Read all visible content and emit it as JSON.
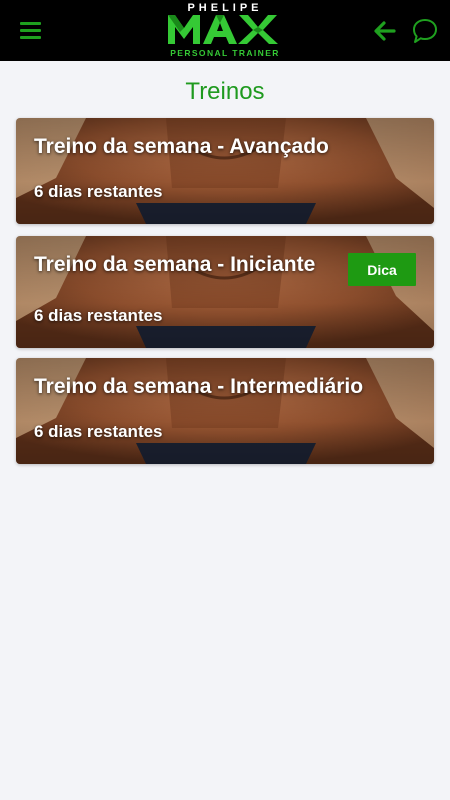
{
  "header": {
    "menu_icon": "hamburger-menu-icon",
    "logo": {
      "top": "PHELIPE",
      "main": "MAX",
      "bottom": "PERSONAL TRAINER"
    },
    "back_icon": "arrow-left-icon",
    "chat_icon": "chat-bubble-icon"
  },
  "page": {
    "title": "Treinos"
  },
  "workouts": [
    {
      "title": "Treino da semana - Avançado",
      "remaining": "6 dias restantes"
    },
    {
      "title": "Treino da semana - Iniciante",
      "remaining": "6 dias restantes",
      "tip_label": "Dica"
    },
    {
      "title": "Treino da semana - Intermediário",
      "remaining": "6 dias restantes"
    }
  ],
  "colors": {
    "accent": "#1f9a1f",
    "header_bg": "#000000",
    "page_bg": "#f3f4f8",
    "tip_button": "#1e9a12"
  }
}
